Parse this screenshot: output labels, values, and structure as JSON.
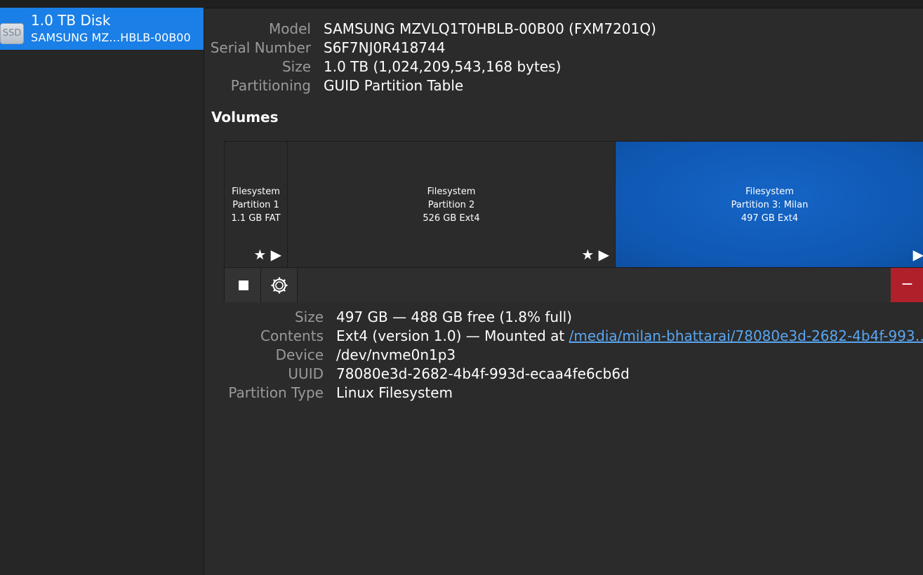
{
  "sidebar": {
    "disk": {
      "icon_label": "SSD",
      "title": "1.0 TB Disk",
      "subtitle": "SAMSUNG MZ…HBLB-00B00"
    }
  },
  "drive_info": {
    "model_label": "Model",
    "model_value": "SAMSUNG MZVLQ1T0HBLB-00B00 (FXM7201Q)",
    "serial_label": "Serial Number",
    "serial_value": "S6F7NJ0R418744",
    "size_label": "Size",
    "size_value": "1.0 TB (1,024,209,543,168 bytes)",
    "partitioning_label": "Partitioning",
    "partitioning_value": "GUID Partition Table"
  },
  "volumes": {
    "heading": "Volumes",
    "partitions": [
      {
        "line1": "Filesystem",
        "line2": "Partition 1",
        "line3": "1.1 GB FAT",
        "selected": false
      },
      {
        "line1": "Filesystem",
        "line2": "Partition 2",
        "line3": "526 GB Ext4",
        "selected": false
      },
      {
        "line1": "Filesystem",
        "line2": "Partition 3: Milan",
        "line3": "497 GB Ext4",
        "selected": true
      }
    ],
    "minus_label": "−"
  },
  "details": {
    "size_label": "Size",
    "size_value": "497 GB — 488 GB free (1.8% full)",
    "contents_label": "Contents",
    "contents_prefix": "Ext4 (version 1.0) — Mounted at",
    "contents_link": "/media/milan-bhattarai/78080e3d-2682-4b4f-993…",
    "device_label": "Device",
    "device_value": "/dev/nvme0n1p3",
    "uuid_label": "UUID",
    "uuid_value": "78080e3d-2682-4b4f-993d-ecaa4fe6cb6d",
    "ptype_label": "Partition Type",
    "ptype_value": "Linux Filesystem"
  },
  "icons": {
    "star": "★",
    "play": "▶",
    "stop": "square-stop-icon",
    "gear": "gear-icon"
  },
  "colors": {
    "selection_blue": "#1a7fe6",
    "partition_selected": "#0f57b1",
    "delete_red": "#b0202a",
    "link": "#5aa6f0"
  }
}
